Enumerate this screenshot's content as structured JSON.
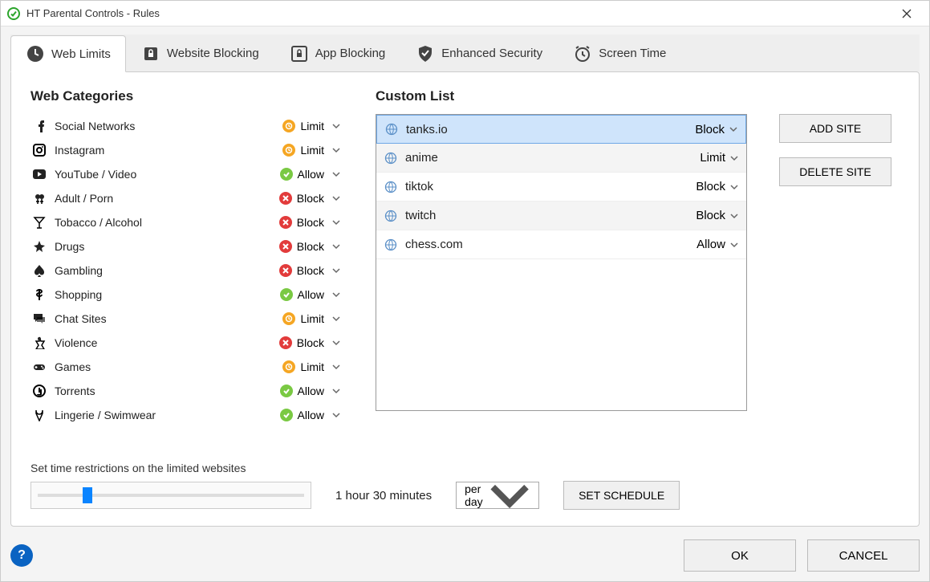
{
  "window": {
    "title": "HT Parental Controls - Rules"
  },
  "tabs": [
    {
      "label": "Web Limits",
      "icon": "clock"
    },
    {
      "label": "Website Blocking",
      "icon": "lock"
    },
    {
      "label": "App Blocking",
      "icon": "applock"
    },
    {
      "label": "Enhanced Security",
      "icon": "shield"
    },
    {
      "label": "Screen Time",
      "icon": "alarm"
    }
  ],
  "headings": {
    "categories": "Web Categories",
    "custom": "Custom List"
  },
  "actions": {
    "Allow": "Allow",
    "Block": "Block",
    "Limit": "Limit"
  },
  "categories": [
    {
      "icon": "facebook",
      "label": "Social Networks",
      "action": "Limit"
    },
    {
      "icon": "instagram",
      "label": "Instagram",
      "action": "Limit"
    },
    {
      "icon": "youtube",
      "label": "YouTube / Video",
      "action": "Allow"
    },
    {
      "icon": "adult",
      "label": "Adult / Porn",
      "action": "Block"
    },
    {
      "icon": "cocktail",
      "label": "Tobacco / Alcohol",
      "action": "Block"
    },
    {
      "icon": "leaf",
      "label": "Drugs",
      "action": "Block"
    },
    {
      "icon": "spade",
      "label": "Gambling",
      "action": "Block"
    },
    {
      "icon": "dollar",
      "label": "Shopping",
      "action": "Allow"
    },
    {
      "icon": "chat",
      "label": "Chat Sites",
      "action": "Limit"
    },
    {
      "icon": "violence",
      "label": "Violence",
      "action": "Block"
    },
    {
      "icon": "gamepad",
      "label": "Games",
      "action": "Limit"
    },
    {
      "icon": "torrent",
      "label": "Torrents",
      "action": "Allow"
    },
    {
      "icon": "swimwear",
      "label": "Lingerie / Swimwear",
      "action": "Allow"
    }
  ],
  "customList": [
    {
      "name": "tanks.io",
      "action": "Block",
      "selected": true
    },
    {
      "name": "anime",
      "action": "Limit",
      "selected": false
    },
    {
      "name": "tiktok",
      "action": "Block",
      "selected": false
    },
    {
      "name": "twitch",
      "action": "Block",
      "selected": false
    },
    {
      "name": "chess.com",
      "action": "Allow",
      "selected": false
    }
  ],
  "buttons": {
    "addSite": "ADD SITE",
    "deleteSite": "DELETE SITE",
    "setSchedule": "SET SCHEDULE",
    "ok": "OK",
    "cancel": "CANCEL"
  },
  "restriction": {
    "label": "Set time restrictions on the limited websites",
    "sliderPercent": 17,
    "timeText": "1 hour 30 minutes",
    "perOptions": [
      "per day"
    ],
    "perSelected": "per day"
  }
}
